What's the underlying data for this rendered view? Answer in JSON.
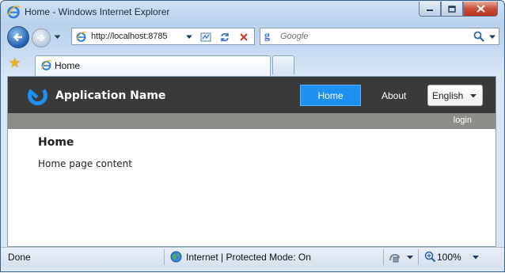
{
  "window": {
    "title": "Home - Windows Internet Explorer",
    "controls": [
      "minimize-icon",
      "maximize-icon",
      "close-icon"
    ]
  },
  "navbar": {
    "address": "http://localhost:8785",
    "search_placeholder": "Google"
  },
  "tabs": [
    {
      "label": "Home",
      "icon": "ie-page-icon"
    }
  ],
  "site": {
    "app_name": "Application Name",
    "nav": [
      {
        "label": "Home",
        "active": true
      },
      {
        "label": "About",
        "active": false
      }
    ],
    "language": {
      "selected": "English"
    },
    "login_label": "login",
    "page_title": "Home",
    "page_content": "Home page content"
  },
  "statusbar": {
    "status": "Done",
    "zone": "Internet | Protected Mode: On",
    "zoom": "100%"
  },
  "colors": {
    "site_header": "#3a3a3a",
    "active_nav": "#1e90f0",
    "login_bar": "#8c8c89",
    "logo": "#1e90f0"
  }
}
